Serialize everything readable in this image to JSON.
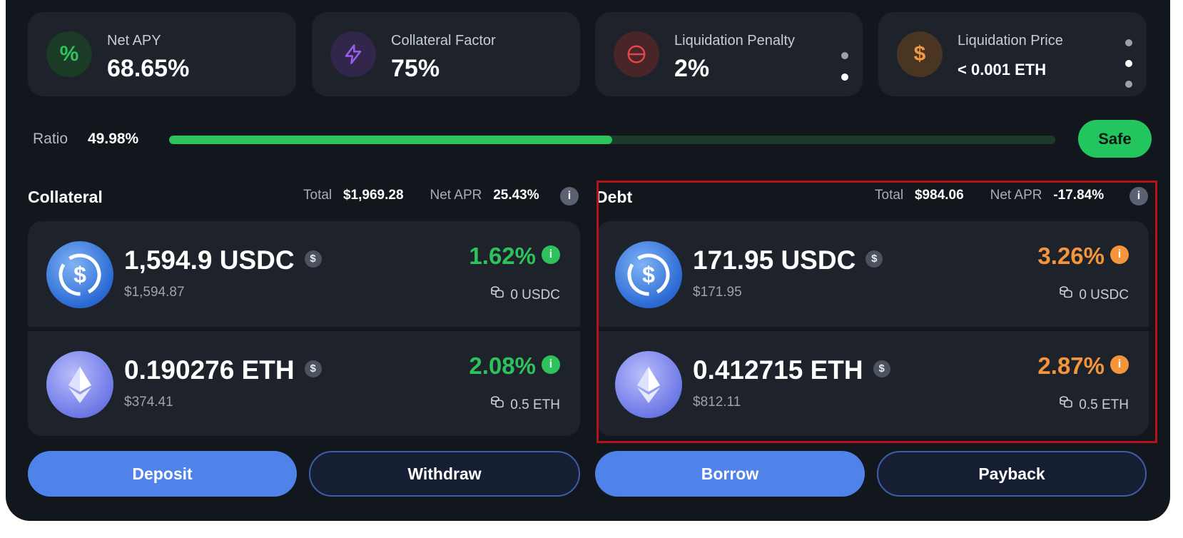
{
  "stats": [
    {
      "label": "Net APY",
      "value": "68.65%",
      "icon": "percent-icon",
      "icon_color": "#2ec25c",
      "icon_bg": "#1b3b27"
    },
    {
      "label": "Collateral Factor",
      "value": "75%",
      "icon": "lightning-icon",
      "icon_color": "#9b5cf0",
      "icon_bg": "#32264a"
    },
    {
      "label": "Liquidation Penalty",
      "value": "2%",
      "icon": "minus-circle-icon",
      "icon_color": "#e2474b",
      "icon_bg": "#4a2527"
    },
    {
      "label": "Liquidation Price",
      "value": "< 0.001 ETH",
      "icon": "dollar-icon",
      "icon_color": "#f29a43",
      "icon_bg": "#4a3422"
    }
  ],
  "ratio": {
    "label": "Ratio",
    "value": "49.98%",
    "fill_fraction": 0.5,
    "status": "Safe",
    "status_color": "#22c55e"
  },
  "collateral": {
    "title": "Collateral",
    "total_label": "Total",
    "total_value": "$1,969.28",
    "apr_label": "Net APR",
    "apr_value": "25.43%",
    "assets": [
      {
        "amount": "1,594.9 USDC",
        "usd": "$1,594.87",
        "apr": "1.62%",
        "balance": "0 USDC",
        "icon": "usdc-coin-icon"
      },
      {
        "amount": "0.190276 ETH",
        "usd": "$374.41",
        "apr": "2.08%",
        "balance": "0.5 ETH",
        "icon": "eth-coin-icon"
      }
    ]
  },
  "debt": {
    "title": "Debt",
    "total_label": "Total",
    "total_value": "$984.06",
    "apr_label": "Net APR",
    "apr_value": "-17.84%",
    "assets": [
      {
        "amount": "171.95 USDC",
        "usd": "$171.95",
        "apr": "3.26%",
        "balance": "0 USDC",
        "icon": "usdc-coin-icon"
      },
      {
        "amount": "0.412715 ETH",
        "usd": "$812.11",
        "apr": "2.87%",
        "balance": "0.5 ETH",
        "icon": "eth-coin-icon"
      }
    ]
  },
  "buttons": {
    "deposit": "Deposit",
    "withdraw": "Withdraw",
    "borrow": "Borrow",
    "payback": "Payback"
  },
  "glyphs": {
    "info": "i",
    "dollar": "$",
    "percent": "%"
  },
  "colors": {
    "accent": "#4f83ea",
    "positive": "#2ec25c",
    "warning": "#f5953b",
    "highlight_border": "#b3141a"
  }
}
